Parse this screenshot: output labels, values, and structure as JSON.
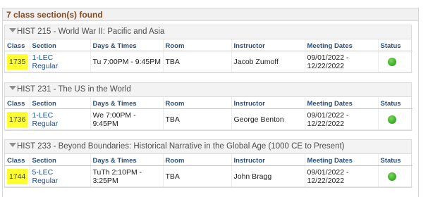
{
  "results": {
    "header": "7 class section(s) found",
    "columns": {
      "class": "Class",
      "section": "Section",
      "days_times": "Days & Times",
      "room": "Room",
      "instructor": "Instructor",
      "meeting_dates": "Meeting Dates",
      "status": "Status"
    },
    "status_color": "#3fae2a",
    "highlight_color": "#ffff2f",
    "groups": [
      {
        "title": "HIST 215 - World War II: Pacific and Asia",
        "row": {
          "class": "1735",
          "section_line1": "1-LEC",
          "section_line2": "Regular",
          "days_times_line1": "Tu 7:00PM - 9:45PM",
          "days_times_line2": "",
          "room": "TBA",
          "instructor": "Jacob Zumoff",
          "dates_line1": "09/01/2022 -",
          "dates_line2": "12/22/2022",
          "status_icon": "open-circle-icon"
        }
      },
      {
        "title": "HIST 231 - The US in the World",
        "row": {
          "class": "1736",
          "section_line1": "1-LEC",
          "section_line2": "Regular",
          "days_times_line1": "We 7:00PM - 9:45PM",
          "days_times_line2": "",
          "room": "TBA",
          "instructor": "George Benton",
          "dates_line1": "09/01/2022 -",
          "dates_line2": "12/22/2022",
          "status_icon": "open-circle-icon"
        }
      },
      {
        "title": "HIST 233 - Beyond Boundaries: Historical Narrative in the Global Age (1000 CE to Present)",
        "row": {
          "class": "1744",
          "section_line1": "5-LEC",
          "section_line2": "Regular",
          "days_times_line1": "TuTh 2:10PM -",
          "days_times_line2": "3:25PM",
          "room": "TBA",
          "instructor": "John Bragg",
          "dates_line1": "09/01/2022 -",
          "dates_line2": "12/22/2022",
          "status_icon": "open-circle-icon"
        }
      }
    ]
  }
}
